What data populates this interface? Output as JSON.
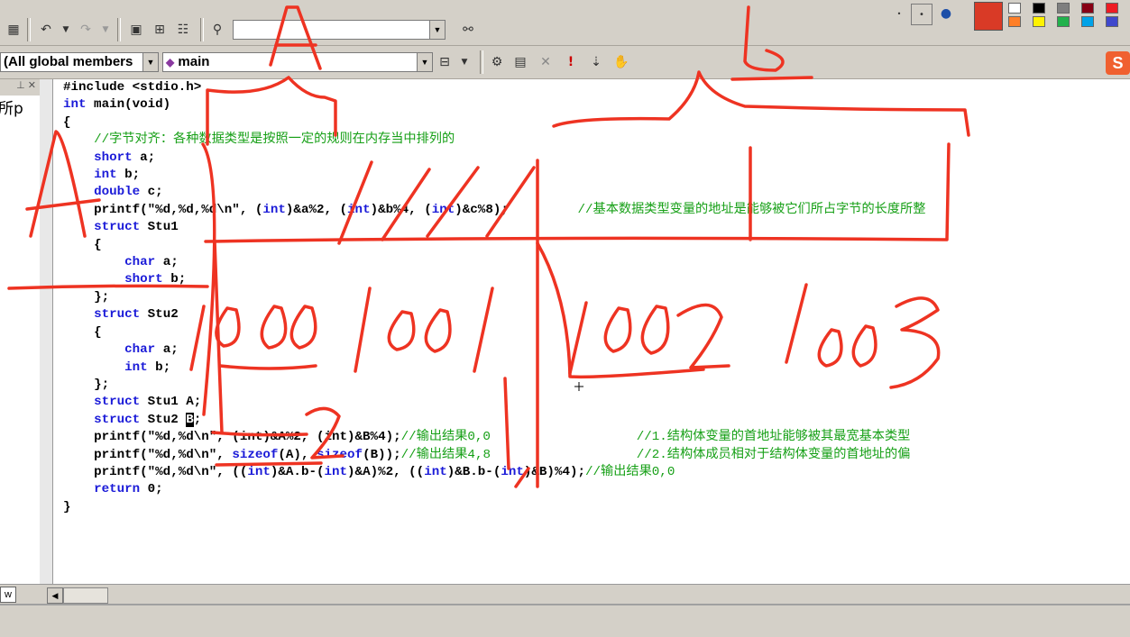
{
  "toolbar": {
    "undo_icon": "undo-icon",
    "redo_icon": "redo-icon",
    "find_combo_value": "",
    "class_combo_value": "(All global members",
    "member_combo_value": "main"
  },
  "palette": {
    "current_color": "#d93a26",
    "colors": [
      "#ffffff",
      "#000000",
      "#7f7f7f",
      "#880015",
      "#ed1c24",
      "#ff7f27",
      "#fff200",
      "#22b14c",
      "#00a2e8",
      "#3f48cc"
    ]
  },
  "code": {
    "line1": "#include <stdio.h>",
    "kw_int": "int",
    "main_sig": " main(void)",
    "brace_open": "{",
    "comment1": "//字节对齐：各种数据类型是按照一定的规则在内存当中排列的",
    "kw_short": "short",
    "var_a": " a;",
    "kw_int2": "int",
    "var_b": " b;",
    "kw_double": "double",
    "var_c": " c;",
    "printf1": "printf(\"%d,%d,%d\\n\", (",
    "printf1_cast1": "int",
    "printf1_mid1": ")&a%2, (",
    "printf1_cast2": "int",
    "printf1_mid2": ")&b%4, (",
    "printf1_cast3": "int",
    "printf1_end": ")&c%8);",
    "comment2": "//基本数据类型变量的地址是能够被它们所占字节的长度所整",
    "kw_struct": "struct",
    "stu1_name": " Stu1",
    "brace": "{",
    "kw_char": "char",
    "member_a": " a;",
    "kw_short2": "short",
    "member_b": " b;",
    "struct_close": "};",
    "kw_struct2": "struct",
    "stu2_name": " Stu2",
    "kw_char2": "char",
    "kw_int3": "int",
    "kw_struct3": "struct",
    "decl_A": " Stu1 A;",
    "kw_struct4": "struct",
    "decl_B_pre": " Stu2 ",
    "decl_B_cursor": "B",
    "decl_B_post": ";",
    "printf2": "printf(\"%d,%d\\n\", (int)&A%2, (int)&B%4);",
    "comment3": "//输出结果0,0",
    "comment4": "//1.结构体变量的首地址能够被其最宽基本类型",
    "printf3_pre": "printf(\"%d,%d\\n\", ",
    "kw_sizeof": "sizeof",
    "printf3_mid": "(A), ",
    "kw_sizeof2": "sizeof",
    "printf3_end": "(B));",
    "comment5": "//输出结果4,8",
    "comment6": "//2.结构体成员相对于结构体变量的首地址的偏",
    "printf4_a": "printf(\"%d,%d\\n\", ((",
    "printf4_b": ")&A.b-(",
    "printf4_c": ")&A)%2, ((",
    "printf4_d": ")&B.b-(",
    "printf4_e": ")&B)%4);",
    "comment7": "//输出结果0,0",
    "kw_return": "return",
    "return_val": " 0;",
    "brace_close": "}"
  },
  "left_panel": {
    "cut_text": "所p",
    "tab_label": "w"
  },
  "annotations": {
    "ink_color": "#ee3322",
    "letters": [
      "A",
      "b",
      "A",
      "2"
    ],
    "addresses": [
      "1000",
      "1001",
      "1002",
      "1003"
    ]
  }
}
